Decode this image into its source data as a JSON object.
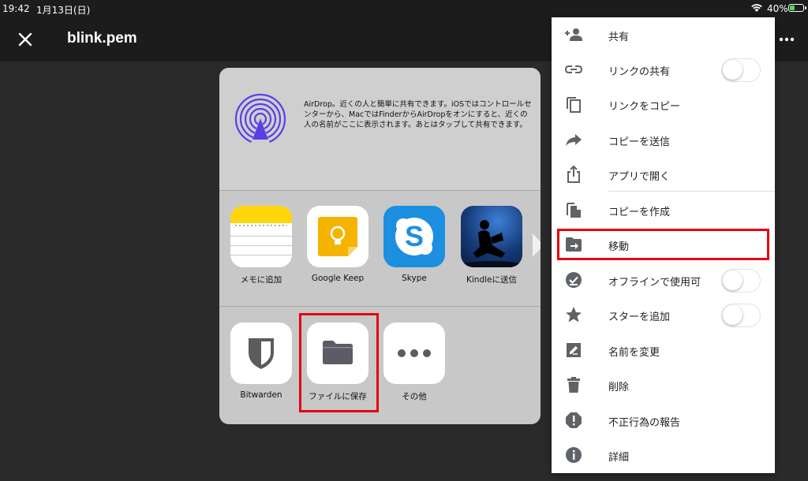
{
  "status_bar": {
    "time": "19:42",
    "date": "1月13日(日)",
    "battery_pct": "40%",
    "battery_level": 0.4
  },
  "header": {
    "title": "blink.pem"
  },
  "share_sheet": {
    "airdrop_text": "AirDrop。近くの人と簡単に共有できます。iOSではコントロールセンターから、MacではFinderからAirDropをオンにすると、近くの人の名前がここに表示されます。あとはタップして共有できます。",
    "apps": [
      {
        "label": "メモに追加"
      },
      {
        "label": "Google Keep"
      },
      {
        "label": "Skype"
      },
      {
        "label": "Kindleに送信"
      }
    ],
    "actions": [
      {
        "label": "Bitwarden"
      },
      {
        "label": "ファイルに保存"
      },
      {
        "label": "その他"
      }
    ]
  },
  "menu": {
    "items": [
      {
        "label": "共有",
        "icon": "add-person-icon"
      },
      {
        "label": "リンクの共有",
        "icon": "link-icon",
        "toggle": false
      },
      {
        "label": "リンクをコピー",
        "icon": "copy-icon"
      },
      {
        "label": "コピーを送信",
        "icon": "forward-icon"
      },
      {
        "label": "アプリで開く",
        "icon": "share-up-icon"
      },
      {
        "label": "コピーを作成",
        "icon": "file-copy-icon"
      },
      {
        "label": "移動",
        "icon": "move-folder-icon"
      },
      {
        "label": "オフラインで使用可",
        "icon": "offline-icon",
        "toggle": false
      },
      {
        "label": "スターを追加",
        "icon": "star-icon",
        "toggle": false
      },
      {
        "label": "名前を変更",
        "icon": "rename-icon"
      },
      {
        "label": "削除",
        "icon": "trash-icon"
      },
      {
        "label": "不正行為の報告",
        "icon": "report-icon"
      },
      {
        "label": "詳細",
        "icon": "info-icon"
      }
    ]
  },
  "colors": {
    "highlight": "#e60012",
    "dark_bg": "#1c1c1c",
    "sheet_bg": "#c8c8c8",
    "menu_bg": "#ffffff"
  }
}
